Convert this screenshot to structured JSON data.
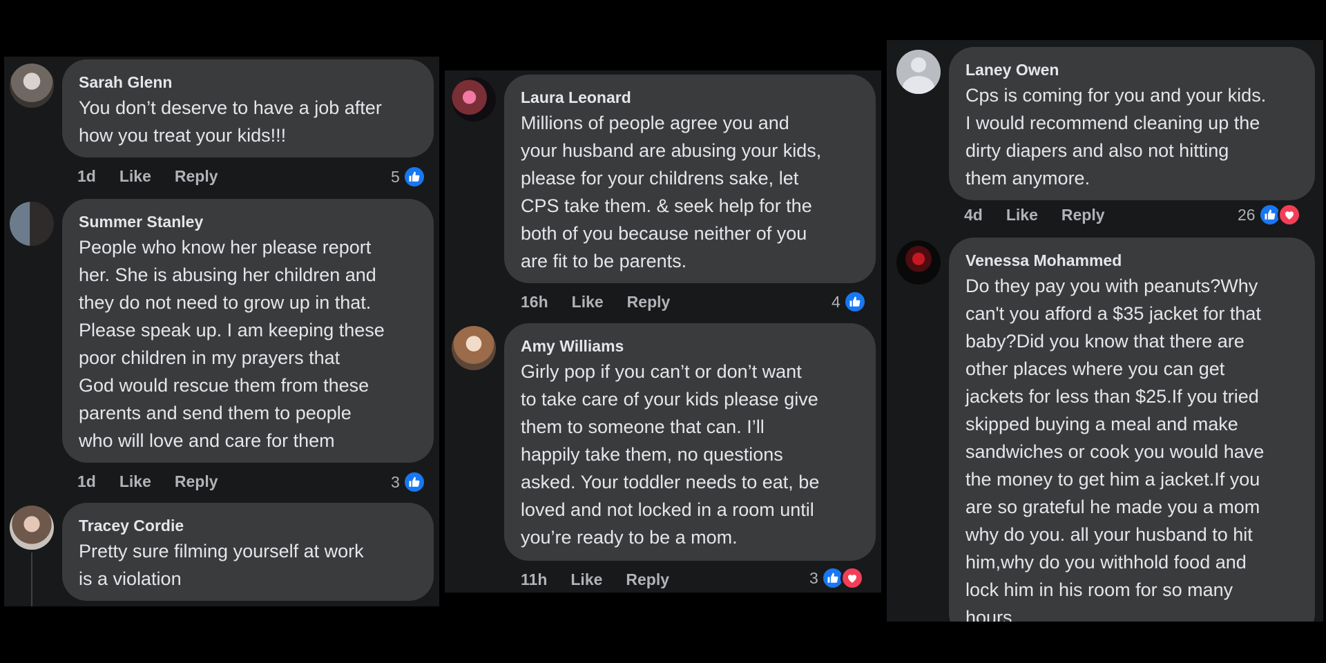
{
  "colors": {
    "background": "#000000",
    "panel": "#18191a",
    "bubble": "#3a3b3c",
    "text_primary": "#e4e6eb",
    "text_secondary": "#b0b3b8",
    "like_blue": "#1877f2",
    "love_red": "#f33e58"
  },
  "panels": [
    {
      "comments": [
        {
          "author": "Sarah Glenn",
          "lines": [
            "You don’t deserve to have a job after",
            "how you treat your kids!!!"
          ],
          "time": "1d",
          "like_label": "Like",
          "reply_label": "Reply",
          "reaction_count": "5",
          "reactions": [
            "like-icon"
          ]
        },
        {
          "author": "Summer Stanley",
          "lines": [
            "People who know her please report",
            "her. She is abusing her children and",
            "they do not need to grow up in that.",
            "Please speak up. I am keeping these",
            "poor children in my prayers that",
            "God would rescue them from these",
            "parents and send them to people",
            "who will love and care for them"
          ],
          "time": "1d",
          "like_label": "Like",
          "reply_label": "Reply",
          "reaction_count": "3",
          "reactions": [
            "like-icon"
          ]
        },
        {
          "author": "Tracey Cordie",
          "lines": [
            "Pretty sure filming yourself at work",
            "is a violation"
          ]
        }
      ]
    },
    {
      "comments": [
        {
          "author": "Laura Leonard",
          "lines": [
            "Millions of people agree you and",
            "your husband are abusing your kids,",
            "please for your childrens sake, let",
            "CPS take them. & seek help for the",
            "both of you because neither of you",
            "are fit to be parents."
          ],
          "time": "16h",
          "like_label": "Like",
          "reply_label": "Reply",
          "reaction_count": "4",
          "reactions": [
            "like-icon"
          ]
        },
        {
          "author": "Amy Williams",
          "lines": [
            "Girly pop if you can’t or don’t want",
            "to take care of your kids please give",
            "them to someone that can. I’ll",
            "happily take them, no questions",
            "asked. Your toddler needs to eat, be",
            "loved and not locked in a room until",
            "you’re ready to be a mom."
          ],
          "time": "11h",
          "like_label": "Like",
          "reply_label": "Reply",
          "reaction_count": "3",
          "reactions": [
            "like-icon",
            "love-icon"
          ]
        }
      ]
    },
    {
      "comments": [
        {
          "author": "Laney Owen",
          "lines": [
            "Cps is coming for you and your kids.",
            "I would recommend cleaning up the",
            "dirty diapers and also not hitting",
            "them anymore."
          ],
          "time": "4d",
          "like_label": "Like",
          "reply_label": "Reply",
          "reaction_count": "26",
          "reactions": [
            "like-icon",
            "love-icon"
          ]
        },
        {
          "author": "Venessa Mohammed",
          "lines": [
            "Do they pay you with peanuts?Why",
            "can't you afford a $35 jacket for that",
            "baby?Did you know that there are",
            "other places where you can get",
            "jackets for less than $25.If you tried",
            "skipped buying a meal and make",
            "sandwiches or cook you would have",
            "the money to get him a jacket.If you",
            "are so grateful he made you a mom",
            "why do you. all your husband to hit",
            "him,why do you withhold food and",
            "lock him in his room for so many",
            "hours"
          ]
        }
      ]
    }
  ]
}
